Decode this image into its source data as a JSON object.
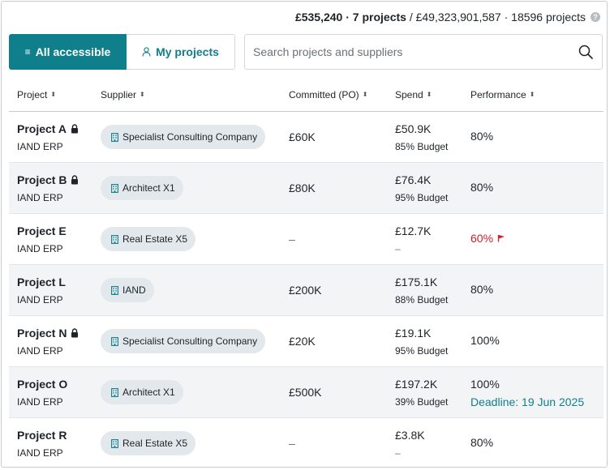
{
  "summary": {
    "amount": "£535,240",
    "projects": "7 projects",
    "total": "/ £49,323,901,587 · 18596 projects",
    "help_icon": "?"
  },
  "view_toggle": {
    "all_label": "All accessible",
    "all_icon": "≡",
    "mine_label": "My projects",
    "mine_icon": "person-icon"
  },
  "search": {
    "placeholder": "Search projects and suppliers",
    "value": ""
  },
  "table": {
    "columns": [
      "Project",
      "Supplier",
      "Committed (PO)",
      "Spend",
      "Performance"
    ],
    "sort_glyph": "⌃⌄",
    "rows": [
      {
        "project": "Project A",
        "locked": true,
        "org": "IAND ERP",
        "supplier": "Specialist Consulting Company",
        "committed": "£60K",
        "spend": "£50.9K",
        "spend_sub": "85% Budget",
        "performance": "80%",
        "warn": false,
        "deadline": ""
      },
      {
        "project": "Project B",
        "locked": true,
        "org": "IAND ERP",
        "supplier": "Architect X1",
        "committed": "£80K",
        "spend": "£76.4K",
        "spend_sub": "95% Budget",
        "performance": "80%",
        "warn": false,
        "deadline": ""
      },
      {
        "project": "Project E",
        "locked": false,
        "org": "IAND ERP",
        "supplier": "Real Estate X5",
        "committed": "–",
        "spend": "£12.7K",
        "spend_sub": "–",
        "performance": "60%",
        "warn": true,
        "deadline": ""
      },
      {
        "project": "Project L",
        "locked": false,
        "org": "IAND ERP",
        "supplier": "IAND",
        "committed": "£200K",
        "spend": "£175.1K",
        "spend_sub": "88% Budget",
        "performance": "80%",
        "warn": false,
        "deadline": ""
      },
      {
        "project": "Project N",
        "locked": true,
        "org": "IAND ERP",
        "supplier": "Specialist Consulting Company",
        "committed": "£20K",
        "spend": "£19.1K",
        "spend_sub": "95% Budget",
        "performance": "100%",
        "warn": false,
        "deadline": ""
      },
      {
        "project": "Project O",
        "locked": false,
        "org": "IAND ERP",
        "supplier": "Architect X1",
        "committed": "£500K",
        "spend": "£197.2K",
        "spend_sub": "39% Budget",
        "performance": "100%",
        "warn": false,
        "deadline": "Deadline: 19 Jun 2025"
      },
      {
        "project": "Project R",
        "locked": false,
        "org": "IAND ERP",
        "supplier": "Real Estate X5",
        "committed": "–",
        "spend": "£3.8K",
        "spend_sub": "–",
        "performance": "80%",
        "warn": false,
        "deadline": ""
      }
    ]
  },
  "colors": {
    "accent": "#0f7f8c",
    "warning": "#d0202e",
    "chip_bg": "#e2e8eb",
    "row_alt": "#f2f4f5"
  }
}
